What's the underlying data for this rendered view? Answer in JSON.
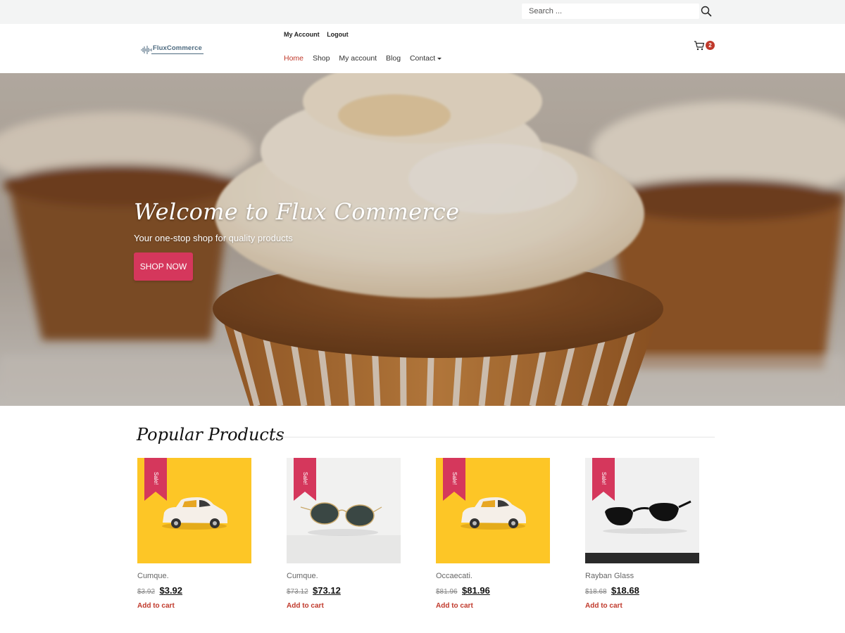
{
  "search": {
    "placeholder": "Search ..."
  },
  "logo": {
    "text": "FluxCommerce"
  },
  "account_links": {
    "my_account": "My Account",
    "logout": "Logout"
  },
  "nav": {
    "home": "Home",
    "shop": "Shop",
    "my_account": "My account",
    "blog": "Blog",
    "contact": "Contact"
  },
  "cart": {
    "count": "2"
  },
  "hero": {
    "title": "Welcome to Flux Commerce",
    "subtitle": "Your one-stop shop for quality products",
    "button": "SHOP NOW"
  },
  "popular": {
    "title": "Popular Products",
    "products": [
      {
        "name": "Cumque.",
        "old_price": "$3.92",
        "price": "$3.92",
        "badge": "Sale!",
        "add_to_cart": "Add to cart",
        "image": "yellow-toy-car"
      },
      {
        "name": "Cumque.",
        "old_price": "$73.12",
        "price": "$73.12",
        "badge": "Sale!",
        "add_to_cart": "Add to cart",
        "image": "round-sunglasses"
      },
      {
        "name": "Occaecati.",
        "old_price": "$81.96",
        "price": "$81.96",
        "badge": "Sale!",
        "add_to_cart": "Add to cart",
        "image": "yellow-toy-car"
      },
      {
        "name": "Rayban Glass",
        "old_price": "$18.68",
        "price": "$18.68",
        "badge": "Sale!",
        "add_to_cart": "Add to cart",
        "image": "black-sunglasses"
      }
    ]
  },
  "colors": {
    "accent": "#d5375c",
    "nav_active": "#c0392b",
    "topbar_bg": "#f3f4f4",
    "product_yellow": "#fdc626"
  }
}
